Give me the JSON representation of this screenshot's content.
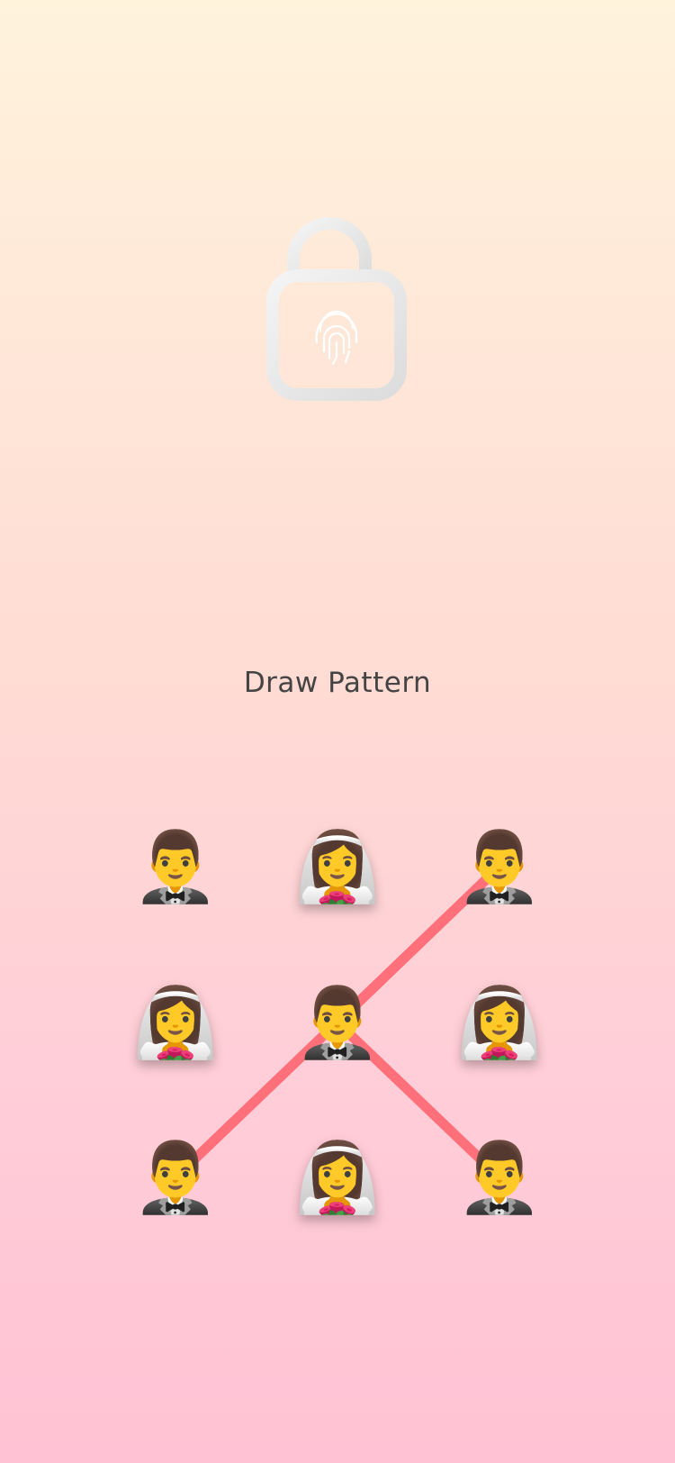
{
  "title": "Draw Pattern",
  "lock_icon": "unlocked-padlock-fingerprint-icon",
  "pattern": {
    "line_color": "#ff707a",
    "nodes": [
      {
        "emoji": "🤵‍♂️",
        "name": "man-in-tuxedo",
        "selected": false
      },
      {
        "emoji": "👰‍♀️",
        "name": "bride-with-veil",
        "selected": true
      },
      {
        "emoji": "🤵‍♂️",
        "name": "man-in-tuxedo",
        "selected": false
      },
      {
        "emoji": "👰‍♀️",
        "name": "bride-with-veil",
        "selected": true
      },
      {
        "emoji": "🤵‍♂️",
        "name": "man-in-tuxedo",
        "selected": false
      },
      {
        "emoji": "👰‍♀️",
        "name": "bride-with-veil",
        "selected": true
      },
      {
        "emoji": "🤵‍♂️",
        "name": "man-in-tuxedo",
        "selected": false
      },
      {
        "emoji": "👰‍♀️",
        "name": "bride-with-veil",
        "selected": true
      },
      {
        "emoji": "🤵‍♂️",
        "name": "man-in-tuxedo",
        "selected": false
      }
    ],
    "sequence": [
      6,
      2,
      4,
      8
    ]
  }
}
